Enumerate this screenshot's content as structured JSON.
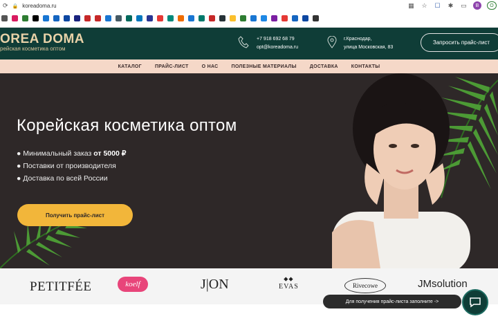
{
  "browser": {
    "url": "koreadoma.ru",
    "avatar_letter": "B",
    "update_label": "O",
    "bookmark_colors": [
      "#555555",
      "#d81b60",
      "#2e7d32",
      "#000000",
      "#1976d2",
      "#1565c0",
      "#0d47a1",
      "#1a237e",
      "#c62828",
      "#c62828",
      "#1976d2",
      "#455a64",
      "#00695c",
      "#0277bd",
      "#283593",
      "#e53935",
      "#00897b",
      "#ef6c00",
      "#1976d2",
      "#00796b",
      "#c62828",
      "#263238",
      "#fbc02d",
      "#2e7d32",
      "#1976d2",
      "#1e88e5",
      "#7b1fa2",
      "#e53935",
      "#1565c0",
      "#0d47a1",
      "#333333"
    ]
  },
  "header": {
    "logo_title": "OREA DOMA",
    "logo_subtitle": "рейская косметика оптом",
    "phone": "+7 918 692 68 79",
    "email": "opt@koreadoma.ru",
    "address_line1": "г.Краснодар,",
    "address_line2": "улица Московская, 83",
    "price_button": "Запросить прайс-лист",
    "bg_color": "#0f3d37",
    "accent_color": "#e8d2a8"
  },
  "nav": {
    "items": [
      "КАТАЛОГ",
      "ПРАЙС-ЛИСТ",
      "О НАС",
      "ПОЛЕЗНЫЕ МАТЕРИАЛЫ",
      "ДОСТАВКА",
      "КОНТАКТЫ"
    ],
    "bg_color": "#f5d8c8"
  },
  "hero": {
    "title": "Корейская косметика оптом",
    "bullet1_prefix": "● Минимальный заказ ",
    "bullet1_bold": "от 5000 ₽",
    "bullet2": "● Поставки от производителя",
    "bullet3": "● Доставка по всей России",
    "cta": "Получить прайс-лист",
    "cta_color": "#f2b63a",
    "bg_color": "#2e2828"
  },
  "brands": {
    "b1": "PETITFÉE",
    "b2": "koelf",
    "b3": "J|ON",
    "b4_top": "⬥⬥",
    "b4": "EVAS",
    "b5": "Rivecowe",
    "b6": "JMsolution"
  },
  "tooltip": {
    "text": "Для получения прайс-листа заполните ->"
  }
}
